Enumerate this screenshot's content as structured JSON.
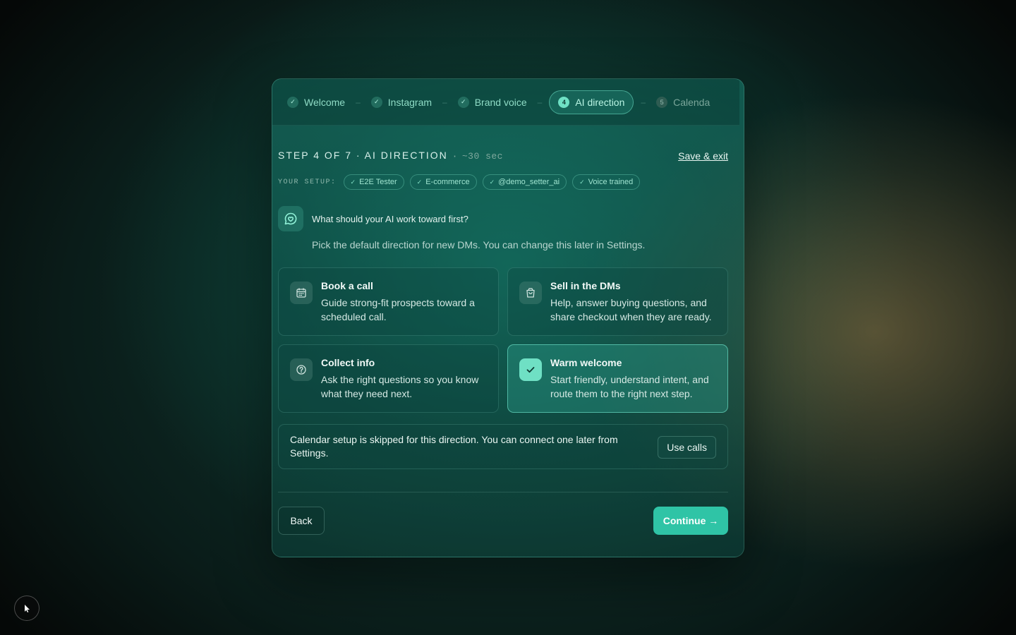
{
  "stepper": {
    "steps": [
      {
        "label": "Welcome",
        "state": "done"
      },
      {
        "label": "Instagram",
        "state": "done"
      },
      {
        "label": "Brand voice",
        "state": "done"
      },
      {
        "label": "AI direction",
        "state": "active",
        "number": "4"
      },
      {
        "label": "Calenda",
        "state": "future",
        "number": "5"
      }
    ],
    "separator": "–"
  },
  "header": {
    "title": "STEP 4 OF 7 · AI DIRECTION",
    "dot": "·",
    "time": "~30 sec",
    "save_exit": "Save & exit"
  },
  "setup": {
    "label": "YOUR SETUP:",
    "chips": [
      "E2E Tester",
      "E-commerce",
      "@demo_setter_ai",
      "Voice trained"
    ]
  },
  "question": {
    "text": "What should your AI work toward first?",
    "hint": "Pick the default direction for new DMs. You can change this later in Settings."
  },
  "options": [
    {
      "title": "Book a call",
      "desc": "Guide strong-fit prospects toward a scheduled call.",
      "icon": "calendar-icon",
      "selected": false
    },
    {
      "title": "Sell in the DMs",
      "desc": "Help, answer buying questions, and share checkout when they are ready.",
      "icon": "shopping-bag-icon",
      "selected": false
    },
    {
      "title": "Collect info",
      "desc": "Ask the right questions so you know what they need next.",
      "icon": "question-circle-icon",
      "selected": false
    },
    {
      "title": "Warm welcome",
      "desc": "Start friendly, understand intent, and route them to the right next step.",
      "icon": "check-icon",
      "selected": true
    }
  ],
  "notice": {
    "text": "Calendar setup is skipped for this direction. You can connect one later from Settings.",
    "button": "Use calls"
  },
  "footer": {
    "back": "Back",
    "continue": "Continue →"
  },
  "colors": {
    "accent": "#2fc4a6",
    "accent_light": "#6fe0c4"
  }
}
